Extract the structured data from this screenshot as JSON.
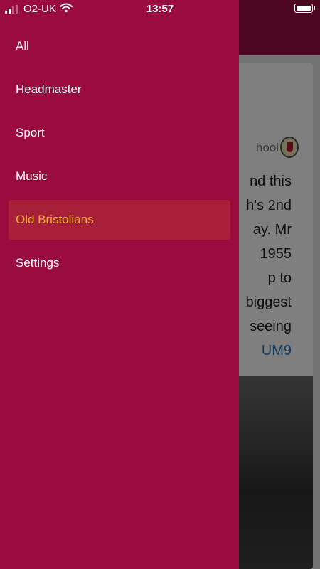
{
  "status_bar": {
    "carrier": "O2-UK",
    "time": "13:57"
  },
  "drawer": {
    "items": [
      {
        "label": "All",
        "active": false
      },
      {
        "label": "Headmaster",
        "active": false
      },
      {
        "label": "Sport",
        "active": false
      },
      {
        "label": "Music",
        "active": false
      },
      {
        "label": "Old Bristolians",
        "active": true
      },
      {
        "label": "Settings",
        "active": false
      }
    ],
    "background_color": "#9a0c3e",
    "active_item_color": "#f2b42a"
  },
  "background_card": {
    "source_name": "hool",
    "text_lines": [
      "nd this",
      "h's 2nd",
      "ay. Mr",
      "1955",
      "p to",
      "biggest",
      "seeing"
    ],
    "link_text": "UM9"
  }
}
